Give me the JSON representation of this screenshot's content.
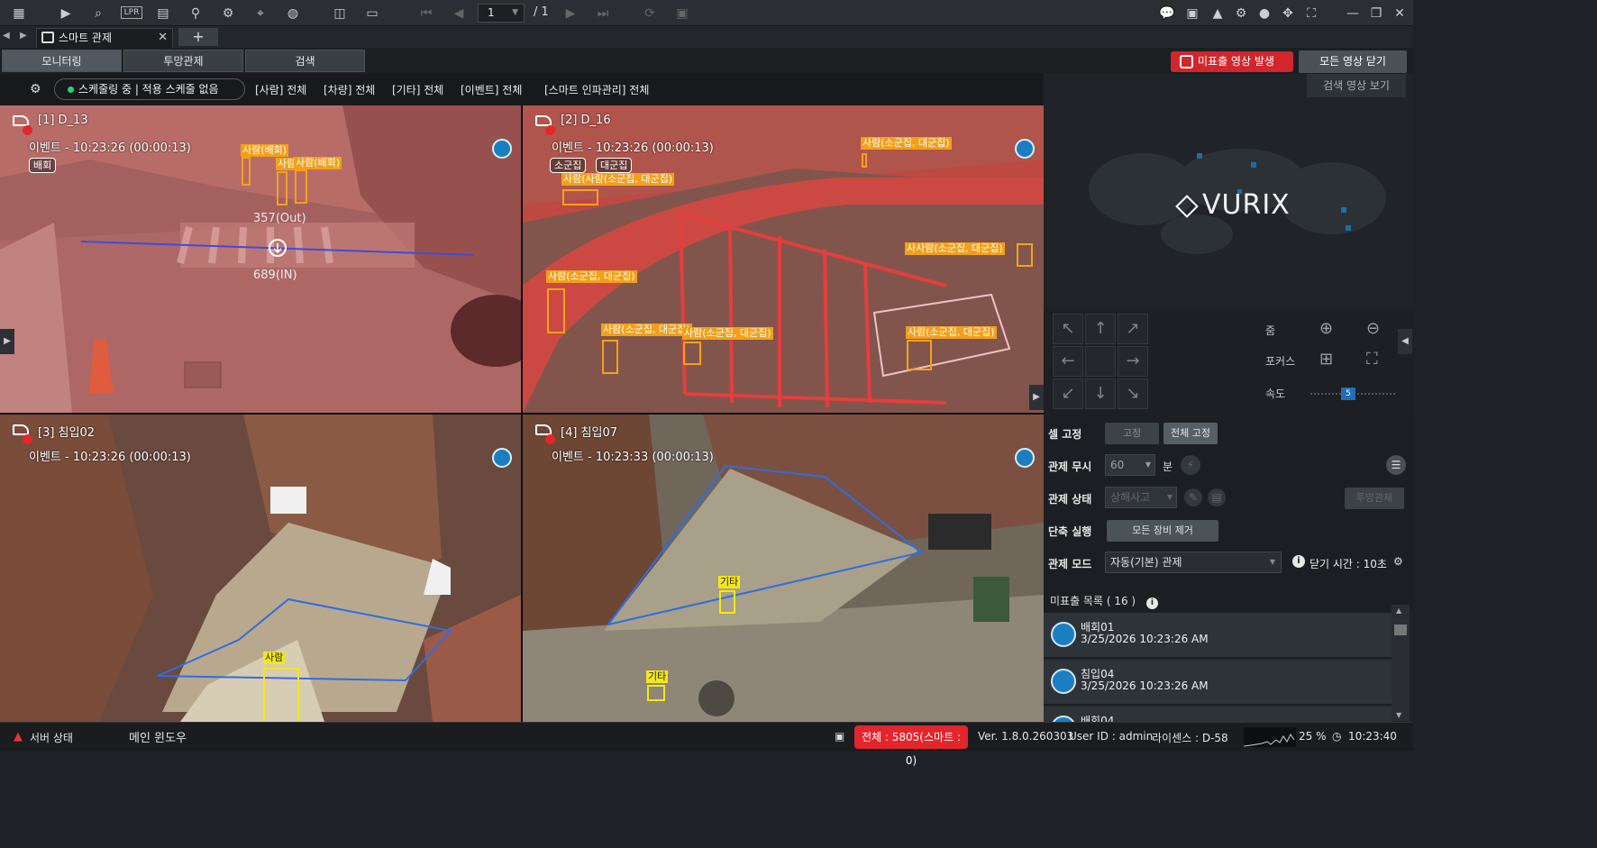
{
  "toolbar": {
    "page": "1",
    "page_total": "/ 1"
  },
  "tab": {
    "title": "스마트 관제",
    "add": "+"
  },
  "modes": [
    "모니터링",
    "투망관제",
    "검색"
  ],
  "header_buttons": {
    "alert": "미표출 영상 발생",
    "close_all": "모든 영상 닫기",
    "search_video": "검색 영상 보기"
  },
  "filters": {
    "schedule": "스케줄링 중 | 적용 스케줄 없음",
    "items": [
      "[사람] 전체",
      "[차량] 전체",
      "[기타] 전체",
      "[이벤트] 전체",
      "[스마트 인파관리] 전체"
    ]
  },
  "cameras": [
    {
      "name": "[1] D_13",
      "event": "이벤트 - 10:23:26 (00:00:13)",
      "chips": [
        "배회"
      ],
      "out": "357(Out)",
      "in": "689(IN)",
      "labels": [
        "사람(배회)",
        "사람(",
        "사람(배회)"
      ]
    },
    {
      "name": "[2] D_16",
      "event": "이벤트 - 10:23:26 (00:00:13)",
      "chips": [
        "소군집",
        "대군집"
      ],
      "labels": [
        "사람(소군집, 대군집)",
        "사람(사람(소군집, 대군집)",
        "사람(소군집, 대군집)",
        "사람(소군집, 대군집)",
        "사람(소군집, 대군집)",
        "사람(소군집, 대군집)",
        "사람(소군집, 대군집)",
        "사사람(소군집, 대군집)"
      ]
    },
    {
      "name": "[3] 침입02",
      "event": "이벤트 - 10:23:26 (00:00:13)",
      "labels": [
        "사람"
      ]
    },
    {
      "name": "[4] 침입07",
      "event": "이벤트 - 10:23:33 (00:00:13)",
      "labels": [
        "기타",
        "기타"
      ]
    }
  ],
  "brand": "VURIX",
  "ptz": {
    "zoom": "줌",
    "focus": "포커스",
    "speed": "속도",
    "speed_value": "5"
  },
  "controls": {
    "cell_fix": {
      "label": "셀 고정",
      "fix": "고정",
      "fix_all": "전체 고정"
    },
    "ignore": {
      "label": "관제 무시",
      "value": "60",
      "unit": "분"
    },
    "status": {
      "label": "관제 상태",
      "value": "상해사고",
      "btn": "투망관제"
    },
    "shortcut": {
      "label": "단축 실행",
      "btn": "모든 장비 제거"
    },
    "mode": {
      "label": "관제 모드",
      "value": "자동(기본) 관제",
      "close_time": "닫기 시간 : 10초"
    }
  },
  "list": {
    "header": "미표출 목록 ( 16 )",
    "items": [
      {
        "name": "배회01",
        "time": "3/25/2026 10:23:26 AM"
      },
      {
        "name": "침입04",
        "time": "3/25/2026 10:23:26 AM"
      },
      {
        "name": "배회04",
        "time": ""
      }
    ]
  },
  "status": {
    "server": "서버 상태",
    "window": "메인 윈도우",
    "total": "전체 : 5805(스마트 : 0)",
    "version": "Ver. 1.8.0.260303",
    "user": "User ID : admin",
    "license": "라이센스 : D-58",
    "cpu": "25 %",
    "clock": "10:23:40"
  },
  "colors": {
    "alert": "#e3262c",
    "detect": "#f2a01a",
    "detect_other": "#f4e71b",
    "zone": "#2f6de0",
    "accent": "#1b7ec1"
  }
}
